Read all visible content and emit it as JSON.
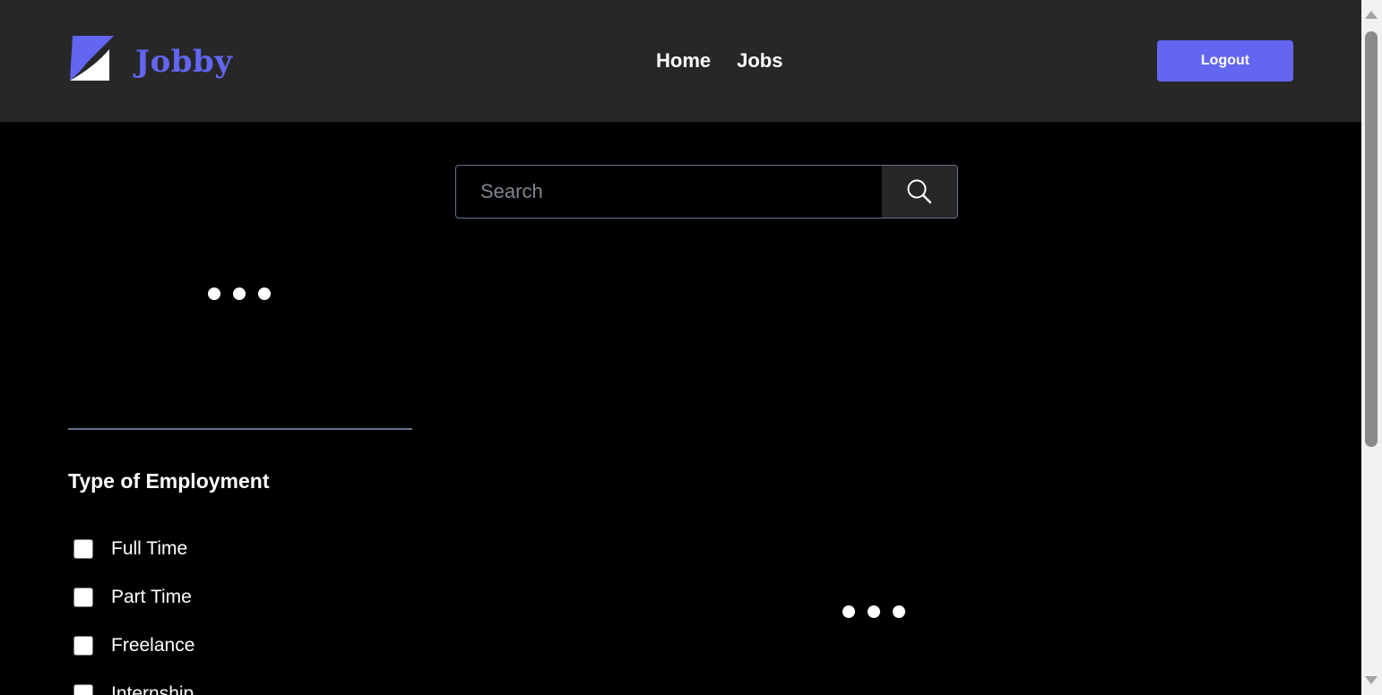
{
  "header": {
    "brand_name": "Jobby",
    "logo_icon": "jobby-logo-icon",
    "nav": [
      {
        "label": "Home"
      },
      {
        "label": "Jobs"
      }
    ],
    "logout_label": "Logout"
  },
  "search": {
    "placeholder": "Search",
    "value": "",
    "button_icon": "search-icon"
  },
  "profile_section": {
    "loader_icon": "three-dots-loader"
  },
  "filters": {
    "employment_heading": "Type of Employment",
    "employment_types": [
      {
        "label": "Full Time",
        "checked": false
      },
      {
        "label": "Part Time",
        "checked": false
      },
      {
        "label": "Freelance",
        "checked": false
      },
      {
        "label": "Internship",
        "checked": false
      }
    ]
  },
  "jobs_section": {
    "loader_icon": "three-dots-loader"
  },
  "colors": {
    "accent": "#6366f1",
    "header_bg": "#272727",
    "page_bg": "#000000",
    "border": "#64748b"
  }
}
